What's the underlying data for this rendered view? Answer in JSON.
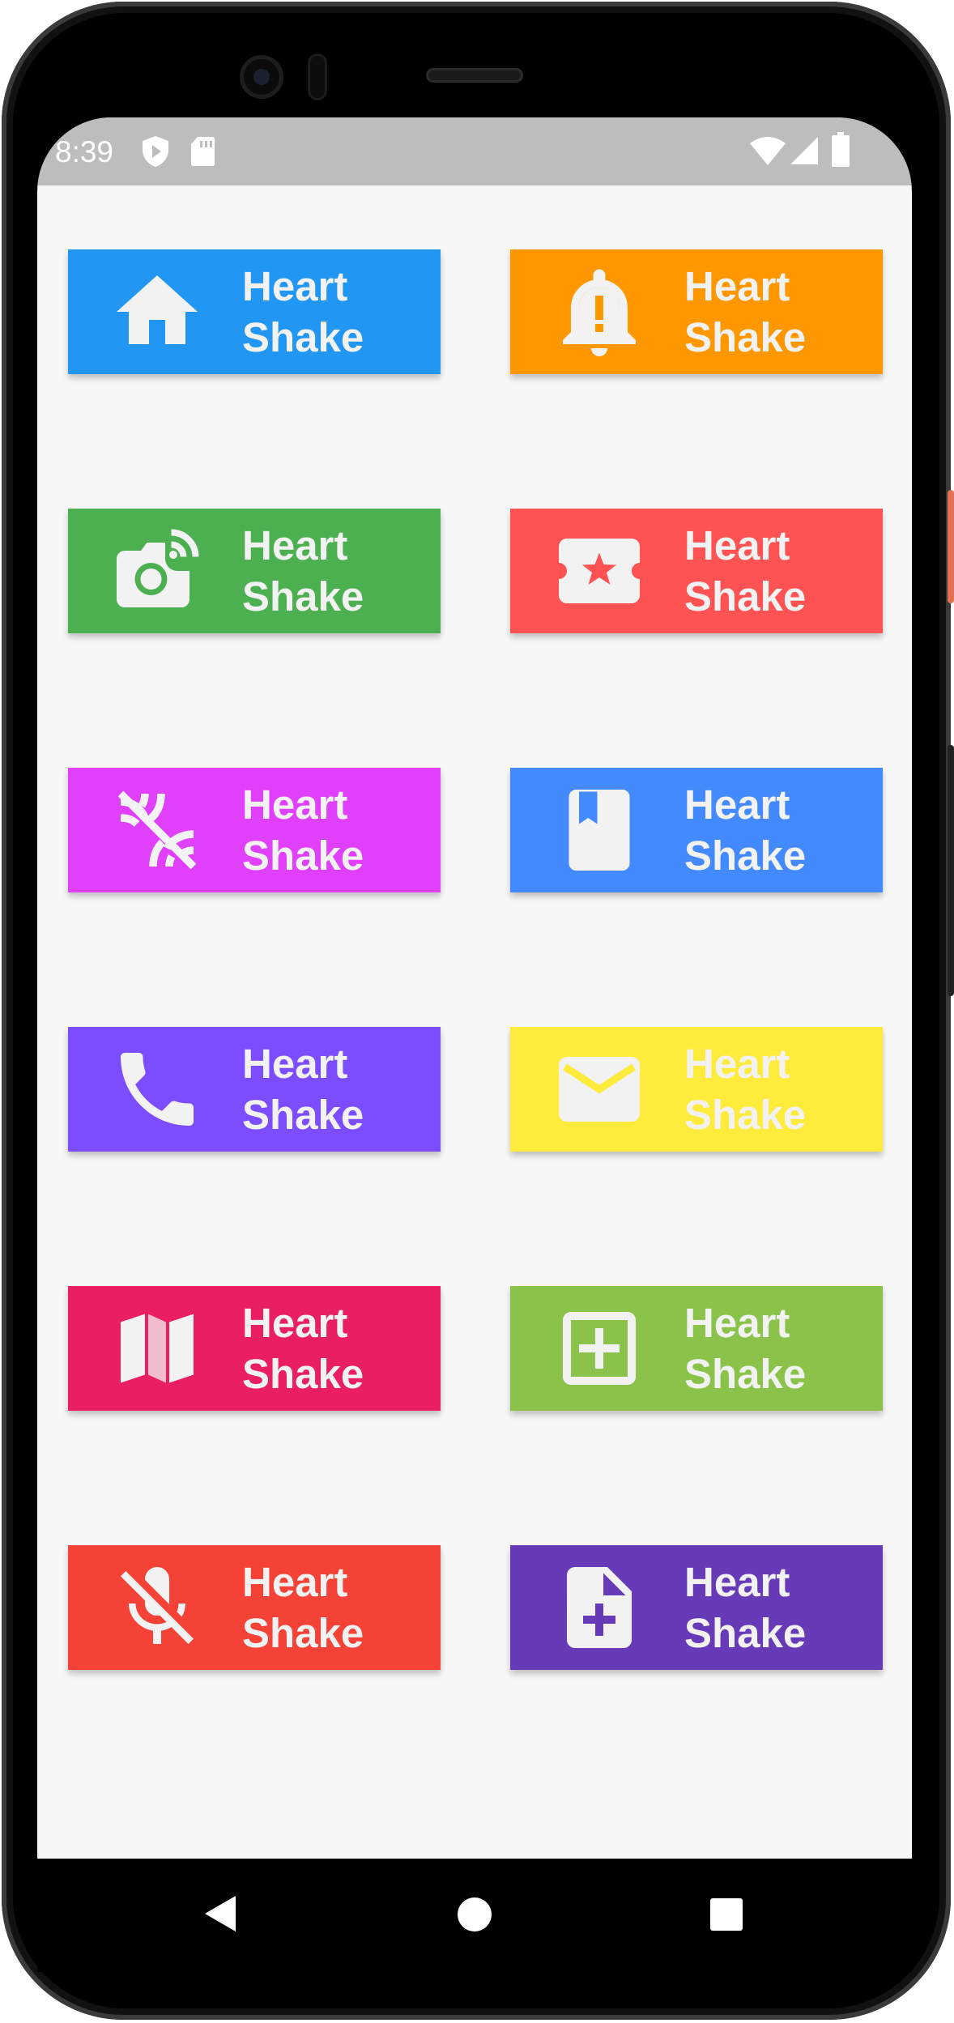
{
  "status_bar": {
    "time": "8:39",
    "left_icons": [
      "shield-play-icon",
      "sd-card-icon"
    ],
    "right_icons": [
      "wifi-icon",
      "cellular-signal-icon",
      "battery-icon"
    ]
  },
  "colors": {
    "screen_bg": "#f7f7f7",
    "status_bar_bg": "#bdbdbd",
    "icon_fg": "#f2f2f2"
  },
  "buttons": [
    {
      "line1": "Heart",
      "line2": "Shake",
      "icon": "home-icon",
      "color": "#2196f3"
    },
    {
      "line1": "Heart",
      "line2": "Shake",
      "icon": "notification-important-icon",
      "color": "#ff9800"
    },
    {
      "line1": "Heart",
      "line2": "Shake",
      "icon": "camera-wireless-icon",
      "color": "#4caf50"
    },
    {
      "line1": "Heart",
      "line2": "Shake",
      "icon": "local-activity-ticket-icon",
      "color": "#ff5252"
    },
    {
      "line1": "Heart",
      "line2": "Shake",
      "icon": "leak-remove-icon",
      "color": "#e040fb"
    },
    {
      "line1": "Heart",
      "line2": "Shake",
      "icon": "book-icon",
      "color": "#448aff"
    },
    {
      "line1": "Heart",
      "line2": "Shake",
      "icon": "phone-icon",
      "color": "#7c4dff"
    },
    {
      "line1": "Heart",
      "line2": "Shake",
      "icon": "mail-icon",
      "color": "#ffeb3b"
    },
    {
      "line1": "Heart",
      "line2": "Shake",
      "icon": "map-icon",
      "color": "#e91e63"
    },
    {
      "line1": "Heart",
      "line2": "Shake",
      "icon": "add-box-icon",
      "color": "#8bc34a"
    },
    {
      "line1": "Heart",
      "line2": "Shake",
      "icon": "mic-off-icon",
      "color": "#f44336"
    },
    {
      "line1": "Heart",
      "line2": "Shake",
      "icon": "note-add-icon",
      "color": "#673ab7"
    }
  ],
  "nav_bar": {
    "buttons": [
      "back-icon",
      "home-circle-icon",
      "recents-icon"
    ]
  }
}
